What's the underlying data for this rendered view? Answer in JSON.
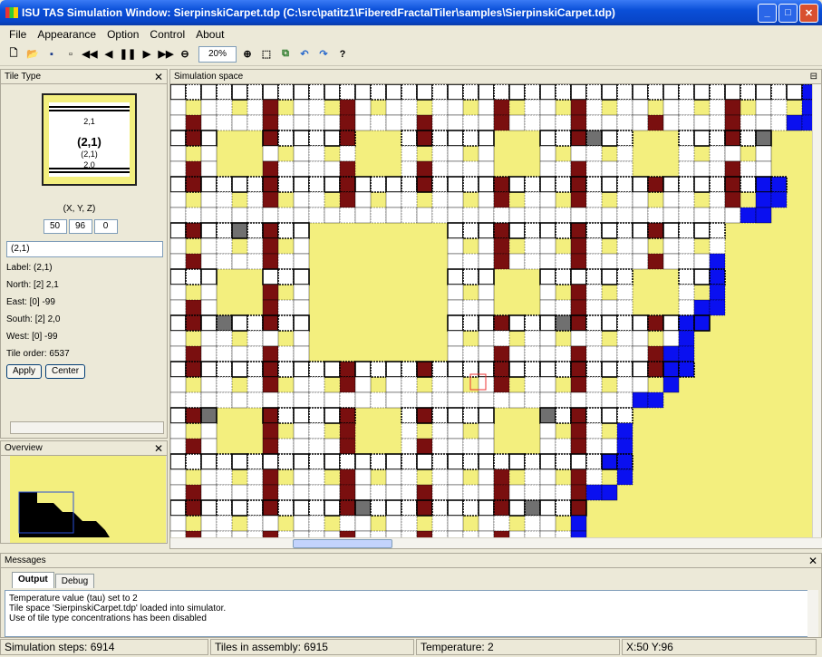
{
  "window": {
    "title": "ISU TAS Simulation Window: SierpinskiCarpet.tdp (C:\\src\\patitz1\\FiberedFractalTiler\\samples\\SierpinskiCarpet.tdp)"
  },
  "menu": [
    "File",
    "Appearance",
    "Option",
    "Control",
    "About"
  ],
  "toolbar": {
    "zoom": "20%",
    "help": "?"
  },
  "tile_panel": {
    "title": "Tile Type",
    "preview": {
      "top": "2,1",
      "name": "(2,1)",
      "sub": "(2,1)",
      "bottom": "2,0"
    },
    "coord_label": "(X, Y, Z)",
    "coords": [
      "50",
      "96",
      "0"
    ],
    "name_field": "(2,1)",
    "info": [
      "Label: (2,1)",
      "North: [2] 2,1",
      "East:  [0] -99",
      "South: [2] 2,0",
      "West:  [0] -99",
      "Tile order: 6537"
    ],
    "apply": "Apply",
    "center": "Center"
  },
  "overview": {
    "title": "Overview"
  },
  "sim": {
    "title": "Simulation space"
  },
  "messages": {
    "title": "Messages",
    "tabs": [
      "Output",
      "Debug"
    ],
    "lines": [
      "Temperature value (tau) set to 2",
      "Tile space 'SierpinskiCarpet.tdp' loaded into simulator.",
      "Use of tile type concentrations has been disabled"
    ]
  },
  "status": [
    "Simulation steps: 6914",
    "Tiles in assembly: 6915",
    "Temperature: 2",
    "X:50   Y:96"
  ],
  "colors": {
    "yellow": "#f3ef7e",
    "maroon": "#7a0f0f",
    "blue": "#0a10f0",
    "gray": "#707070",
    "title_blue": "#0a4fd8"
  }
}
